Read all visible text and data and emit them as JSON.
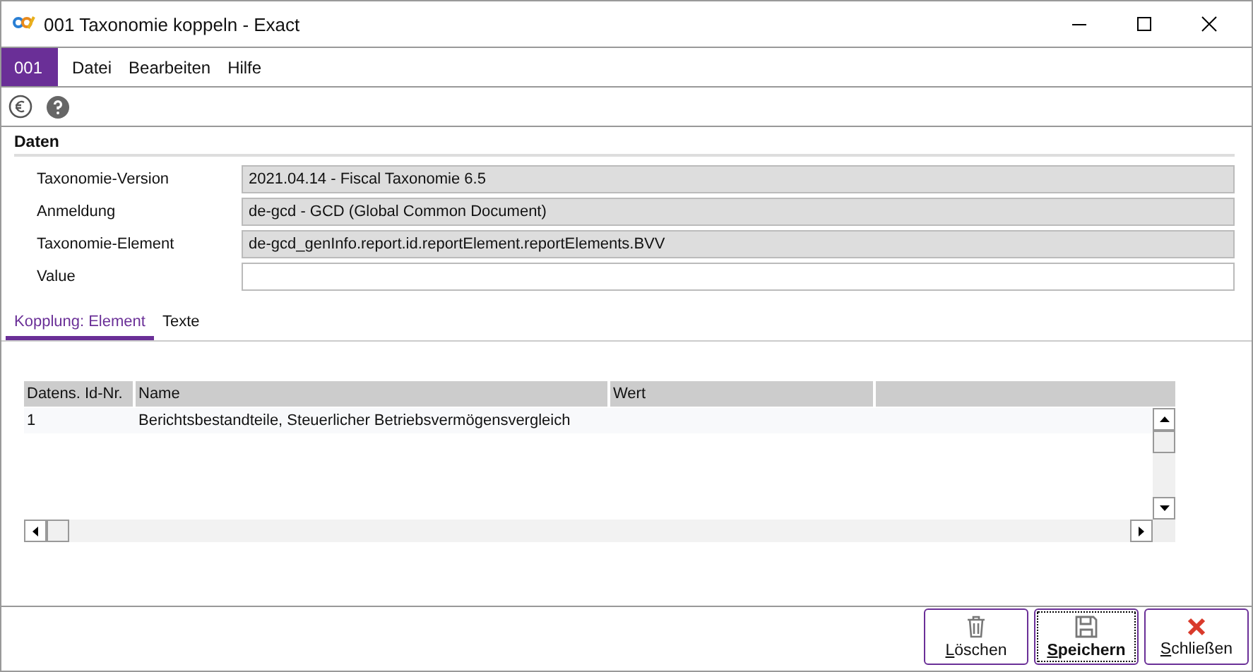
{
  "window": {
    "title": "001 Taxonomie koppeln - Exact"
  },
  "menu": {
    "badge": "001",
    "items": [
      "Datei",
      "Bearbeiten",
      "Hilfe"
    ]
  },
  "section": {
    "title": "Daten"
  },
  "fields": [
    {
      "label": "Taxonomie-Version",
      "value": "2021.04.14 - Fiscal Taxonomie 6.5",
      "disabled": true
    },
    {
      "label": "Anmeldung",
      "value": "de-gcd - GCD (Global Common Document)",
      "disabled": true
    },
    {
      "label": "Taxonomie-Element",
      "value": "de-gcd_genInfo.report.id.reportElement.reportElements.BVV",
      "disabled": true
    },
    {
      "label": "Value",
      "disabled": false
    }
  ],
  "tabs": [
    {
      "label": "Kopplung: Element",
      "selected": true
    },
    {
      "label": "Texte",
      "selected": false
    }
  ],
  "table": {
    "columns": [
      "Datens. Id-Nr.",
      "Name",
      "Wert"
    ],
    "rows": [
      {
        "id": "1",
        "name": "Berichtsbestandteile, Steuerlicher Betriebsvermögensvergleich"
      }
    ]
  },
  "buttons": [
    {
      "label": "Löschen",
      "kind": "delete",
      "default": false
    },
    {
      "label": "Speichern",
      "kind": "save",
      "default": true
    },
    {
      "label": "Schließen",
      "kind": "close",
      "default": false
    }
  ]
}
